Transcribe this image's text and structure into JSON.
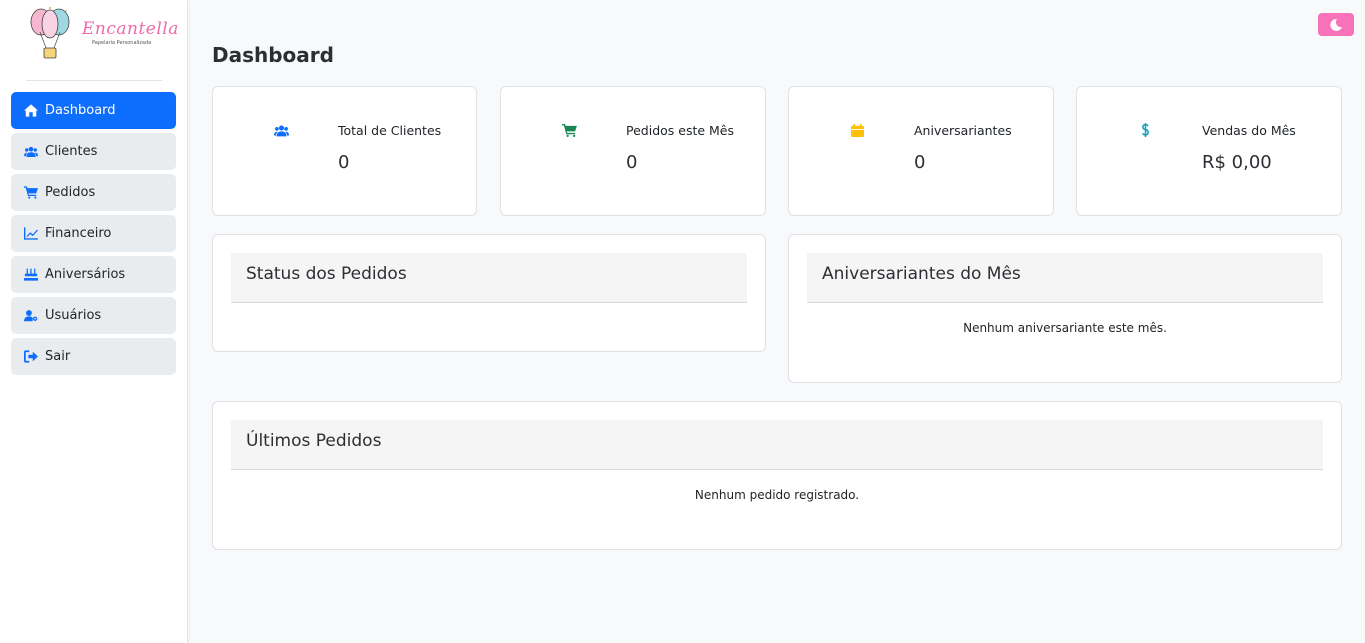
{
  "brand": {
    "name": "Encantella",
    "tagline": "Papelaria Personalizada",
    "accent": "#f06aa8"
  },
  "sidebar": {
    "items": [
      {
        "label": "Dashboard",
        "icon": "home-icon",
        "active": true
      },
      {
        "label": "Clientes",
        "icon": "users-icon",
        "active": false
      },
      {
        "label": "Pedidos",
        "icon": "cart-icon",
        "active": false
      },
      {
        "label": "Financeiro",
        "icon": "chart-line-icon",
        "active": false
      },
      {
        "label": "Aniversários",
        "icon": "birthday-cake-icon",
        "active": false
      },
      {
        "label": "Usuários",
        "icon": "user-cog-icon",
        "active": false
      },
      {
        "label": "Sair",
        "icon": "sign-out-icon",
        "active": false
      }
    ]
  },
  "header": {
    "title": "Dashboard",
    "theme_toggle_icon": "moon-icon",
    "theme_toggle_color": "#f772b8"
  },
  "stats": [
    {
      "label": "Total de Clientes",
      "value": "0",
      "icon": "users-icon",
      "color": "#0d6efd"
    },
    {
      "label": "Pedidos este Mês",
      "value": "0",
      "icon": "cart-icon",
      "color": "#198754"
    },
    {
      "label": "Aniversariantes",
      "value": "0",
      "icon": "calendar-icon",
      "color": "#ffc107"
    },
    {
      "label": "Vendas do Mês",
      "value": "R$ 0,00",
      "icon": "dollar-icon",
      "color": "#0dcaf0"
    }
  ],
  "panels": {
    "status": {
      "title": "Status dos Pedidos"
    },
    "birthdays": {
      "title": "Aniversariantes do Mês",
      "empty": "Nenhum aniversariante este mês."
    },
    "recent": {
      "title": "Últimos Pedidos",
      "empty": "Nenhum pedido registrado."
    }
  }
}
